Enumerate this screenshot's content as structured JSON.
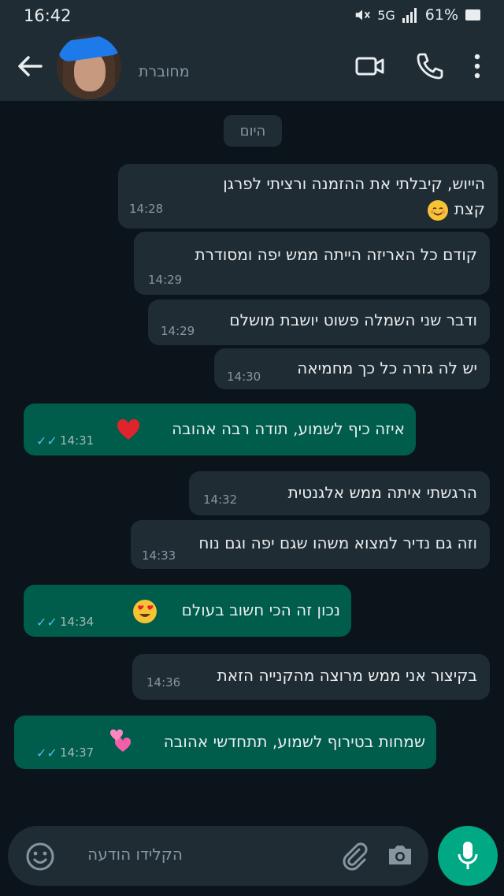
{
  "status_bar": {
    "time": "16:42",
    "network": "5G",
    "battery": "61%"
  },
  "header": {
    "contact_status": "מחוברת"
  },
  "chat": {
    "date_chip": "היום",
    "messages": [
      {
        "dir": "in",
        "line1": "הייוש, קיבלתי את ההזמנה ורציתי לפרגן",
        "line2": "קצת",
        "time": "14:28",
        "emoji": "blush"
      },
      {
        "dir": "in",
        "line1": "קודם כל האריזה הייתה ממש יפה ומסודרת",
        "time": "14:29"
      },
      {
        "dir": "in",
        "line1": "ודבר שני השמלה פשוט יושבת מושלם",
        "time": "14:29"
      },
      {
        "dir": "in",
        "line1": "יש לה גזרה כל כך מחמיאה",
        "time": "14:30"
      },
      {
        "dir": "out",
        "line1": "איזה כיף לשמוע, תודה רבה אהובה",
        "time": "14:31",
        "emoji": "red-heart"
      },
      {
        "dir": "in",
        "line1": "הרגשתי איתה ממש אלגנטית",
        "time": "14:32"
      },
      {
        "dir": "in",
        "line1": "וזה גם נדיר למצוא משהו שגם יפה וגם נוח",
        "time": "14:33"
      },
      {
        "dir": "out",
        "line1": "נכון זה הכי חשוב בעולם",
        "time": "14:34",
        "emoji": "heart-eyes"
      },
      {
        "dir": "in",
        "line1": "בקיצור אני ממש מרוצה מהקנייה הזאת",
        "time": "14:36"
      },
      {
        "dir": "out",
        "line1": "שמחות בטירוף לשמוע, תתחדשי אהובה",
        "time": "14:37",
        "emoji": "two-hearts"
      }
    ]
  },
  "composer": {
    "placeholder": "הקלידו הודעה"
  },
  "icons": {
    "back": "arrow-left-icon",
    "video": "video-call-icon",
    "call": "phone-icon",
    "menu": "more-vert-icon",
    "emoji": "emoji-icon",
    "attach": "paperclip-icon",
    "camera": "camera-icon",
    "mic": "microphone-icon"
  },
  "colors": {
    "incoming": "#202c33",
    "outgoing": "#005c4b",
    "accent": "#00a884",
    "read_ticks": "#53bdeb"
  }
}
